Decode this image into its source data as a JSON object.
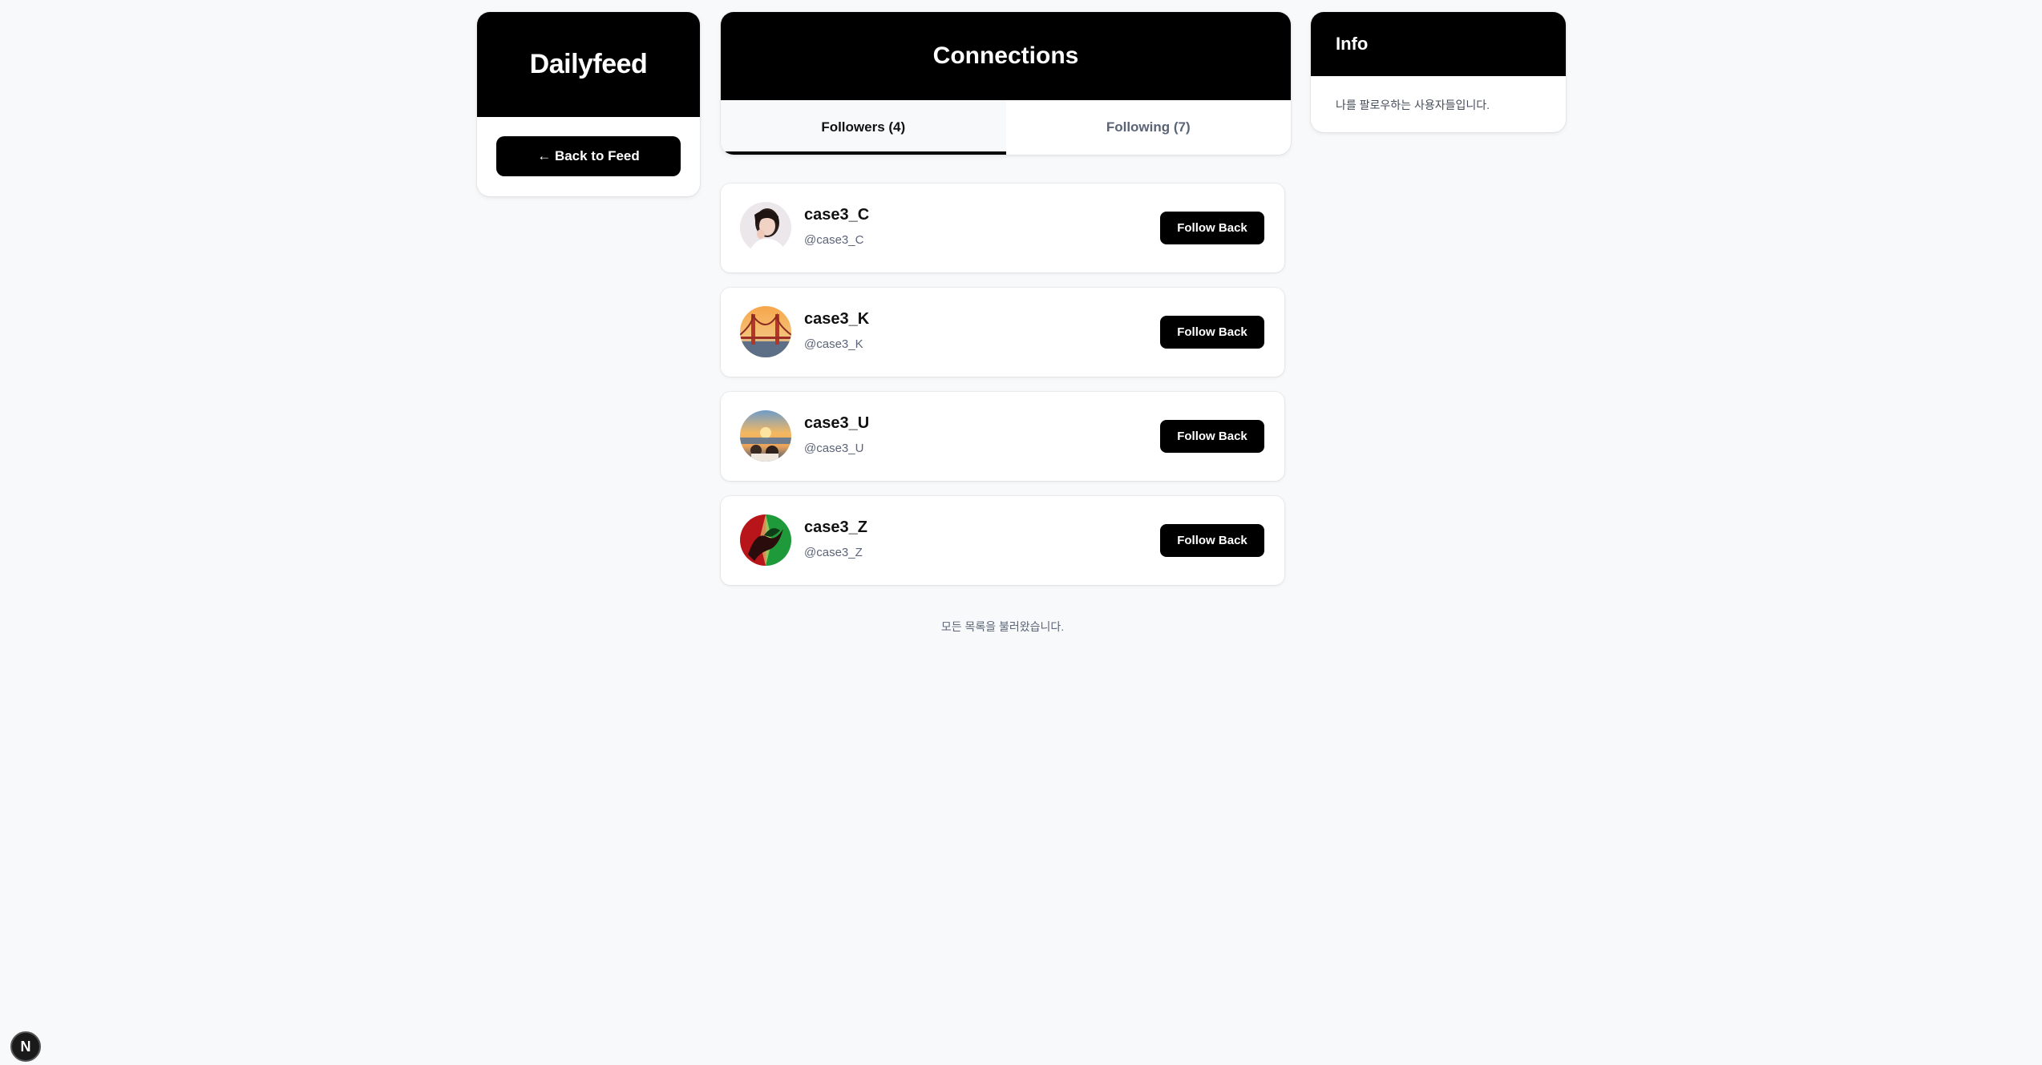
{
  "brand": {
    "name": "Dailyfeed",
    "back_button": "← Back to Feed"
  },
  "connections": {
    "title": "Connections",
    "tabs": [
      {
        "label": "Followers (4)",
        "active": true
      },
      {
        "label": "Following (7)",
        "active": false
      }
    ]
  },
  "info": {
    "title": "Info",
    "text": "나를 팔로우하는 사용자들입니다."
  },
  "followers": [
    {
      "name": "case3_C",
      "handle": "@case3_C",
      "button": "Follow Back",
      "avatar": "woman-portrait-avatar"
    },
    {
      "name": "case3_K",
      "handle": "@case3_K",
      "button": "Follow Back",
      "avatar": "golden-gate-bridge-avatar"
    },
    {
      "name": "case3_U",
      "handle": "@case3_U",
      "button": "Follow Back",
      "avatar": "sunset-beach-avatar"
    },
    {
      "name": "case3_Z",
      "handle": "@case3_Z",
      "button": "Follow Back",
      "avatar": "red-green-dragon-avatar"
    }
  ],
  "end_note": "모든 목록을 불러왔습니다.",
  "dev_badge": {
    "label": "N",
    "icon": "nextjs-icon"
  },
  "colors": {
    "accent": "#000000",
    "background": "#f8f9fb",
    "muted_text": "#5b6477"
  }
}
